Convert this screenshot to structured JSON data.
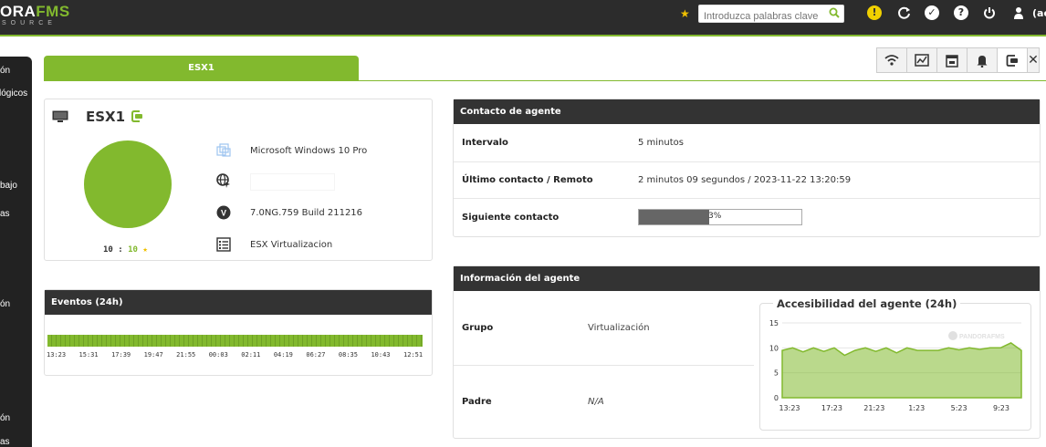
{
  "header": {
    "logo_main": "ORA",
    "logo_accent": "FMS",
    "logo_sub": "SOURCE",
    "search_placeholder": "Introduzca palabras clave",
    "user_label": "(ac"
  },
  "sidebar": {
    "items": [
      "ón",
      "lógicos",
      "bajo",
      "as",
      "ón",
      "ón",
      "as"
    ]
  },
  "agent_tab": {
    "label": "ESX1"
  },
  "tool_tabs": [
    "wifi-icon",
    "chart-icon",
    "calendar-icon",
    "bell-icon",
    "agent-icon",
    "close-icon"
  ],
  "agent": {
    "name": "ESX1",
    "score_left": "10",
    "score_sep": " : ",
    "score_right": "10",
    "os": "Microsoft Windows 10 Pro",
    "ip": "",
    "version": "7.0NG.759 Build 211216",
    "description": "ESX Virtualizacion",
    "status_color": "#82b92e"
  },
  "events": {
    "title": "Eventos (24h)",
    "ticks": [
      "13:23",
      "15:31",
      "17:39",
      "19:47",
      "21:55",
      "00:03",
      "02:11",
      "04:19",
      "06:27",
      "08:35",
      "10:43",
      "12:51"
    ]
  },
  "contact": {
    "title": "Contacto de agente",
    "interval_label": "Intervalo",
    "interval_value": "5 minutos",
    "last_label": "Último contacto / Remoto",
    "last_value": "2 minutos 09 segundos / 2023-11-22 13:20:59",
    "next_label": "Siguiente contacto",
    "next_progress_text": "3%",
    "next_progress": 0.43
  },
  "info": {
    "title": "Información del agente",
    "group_label": "Grupo",
    "group_value": "Virtualización",
    "parent_label": "Padre",
    "parent_value": "N/A",
    "chart_title": "Accesibilidad del agente (24h)",
    "watermark": "PANDORAFMS"
  },
  "chart_data": {
    "type": "area",
    "title": "Accesibilidad del agente (24h)",
    "xlabel": "",
    "ylabel": "",
    "ylim": [
      0,
      15
    ],
    "yticks": [
      "15",
      "10",
      "5",
      "0"
    ],
    "xticks": [
      "13:23",
      "17:23",
      "21:23",
      "1:23",
      "5:23",
      "9:23"
    ],
    "x": [
      0,
      1,
      2,
      3,
      4,
      5,
      6,
      7,
      8,
      9,
      10,
      11,
      12,
      13,
      14,
      15,
      16,
      17,
      18,
      19,
      20,
      21,
      22,
      23
    ],
    "values": [
      9.5,
      10,
      9.2,
      10,
      9.3,
      10,
      8.5,
      9.5,
      10,
      9.3,
      10,
      9,
      10,
      9.5,
      9.5,
      9.5,
      10,
      9.6,
      10,
      9.7,
      10,
      10,
      11,
      9.5
    ],
    "color": "#82b92e",
    "grid": true
  }
}
